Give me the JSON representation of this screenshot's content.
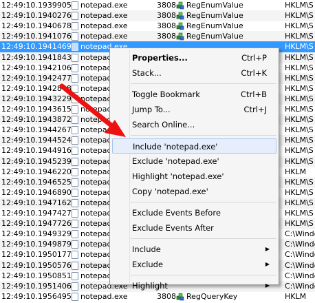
{
  "events": [
    {
      "time": "12:49:10.1939905",
      "process": "notepad.exe",
      "pid": "3808",
      "operation": "RegEnumValue",
      "path": "HKLM\\S"
    },
    {
      "time": "12:49:10.1940276",
      "process": "notepad.exe",
      "pid": "3808",
      "operation": "RegEnumValue",
      "path": "HKLM\\S"
    },
    {
      "time": "12:49:10.1940678",
      "process": "notepad.exe",
      "pid": "3808",
      "operation": "RegEnumValue",
      "path": "HKLM\\S"
    },
    {
      "time": "12:49:10.1941076",
      "process": "notepad.exe",
      "pid": "3808",
      "operation": "RegEnumValue",
      "path": "HKLM\\S"
    },
    {
      "time": "12:49:10.1941469",
      "process": "notepad.exe",
      "pid": "",
      "operation": "",
      "path": "HKLM\\S",
      "selected": true
    },
    {
      "time": "12:49:10.1941843",
      "process": "notepad.exe",
      "pid": "",
      "operation": "",
      "path": "HKLM\\S"
    },
    {
      "time": "12:49:10.1942106",
      "process": "notepad.exe",
      "pid": "",
      "operation": "",
      "path": "HKLM\\S"
    },
    {
      "time": "12:49:10.1942477",
      "process": "notepad.exe",
      "pid": "",
      "operation": "",
      "path": "HKLM\\S"
    },
    {
      "time": "12:49:10.1942848",
      "process": "notepad.exe",
      "pid": "",
      "operation": "",
      "path": "HKLM\\S"
    },
    {
      "time": "12:49:10.1943229",
      "process": "notepad.exe",
      "pid": "",
      "operation": "",
      "path": "HKLM\\S"
    },
    {
      "time": "12:49:10.1943615",
      "process": "notepad.exe",
      "pid": "",
      "operation": "",
      "path": "HKLM\\S"
    },
    {
      "time": "12:49:10.1943872",
      "process": "notepad.exe",
      "pid": "",
      "operation": "",
      "path": "HKLM\\S"
    },
    {
      "time": "12:49:10.1944267",
      "process": "notepad.exe",
      "pid": "",
      "operation": "",
      "path": "HKLM\\S"
    },
    {
      "time": "12:49:10.1944524",
      "process": "notepad.exe",
      "pid": "",
      "operation": "",
      "path": "HKLM\\S"
    },
    {
      "time": "12:49:10.1944916",
      "process": "notepad.exe",
      "pid": "",
      "operation": "",
      "path": "HKLM\\S"
    },
    {
      "time": "12:49:10.1945239",
      "process": "notepad.exe",
      "pid": "",
      "operation": "",
      "path": "HKLM\\S"
    },
    {
      "time": "12:49:10.1946220",
      "process": "notepad.exe",
      "pid": "",
      "operation": "",
      "path": "HKLM"
    },
    {
      "time": "12:49:10.1946525",
      "process": "notepad.exe",
      "pid": "",
      "operation": "",
      "path": "HKLM\\S"
    },
    {
      "time": "12:49:10.1946890",
      "process": "notepad.exe",
      "pid": "",
      "operation": "",
      "path": "HKLM\\S"
    },
    {
      "time": "12:49:10.1947162",
      "process": "notepad.exe",
      "pid": "",
      "operation": "",
      "path": "HKLM\\S"
    },
    {
      "time": "12:49:10.1947427",
      "process": "notepad.exe",
      "pid": "",
      "operation": "",
      "path": "HKLM\\S"
    },
    {
      "time": "12:49:10.1947726",
      "process": "notepad.exe",
      "pid": "",
      "operation": "",
      "path": "HKLM\\S"
    },
    {
      "time": "12:49:10.1949329",
      "process": "notepad.exe",
      "pid": "",
      "operation": "",
      "path": "C:\\Windo"
    },
    {
      "time": "12:49:10.1949879",
      "process": "notepad.exe",
      "pid": "",
      "operation": "",
      "path": "C:\\Windo"
    },
    {
      "time": "12:49:10.1950177",
      "process": "notepad.exe",
      "pid": "",
      "operation": "",
      "path": "C:\\Windo"
    },
    {
      "time": "12:49:10.1950576",
      "process": "notepad.exe",
      "pid": "",
      "operation": "",
      "path": "C:\\Windo"
    },
    {
      "time": "12:49:10.1950851",
      "process": "notepad.exe",
      "pid": "",
      "operation": "",
      "path": "C:\\Windo"
    },
    {
      "time": "12:49:10.1951406",
      "process": "notepad.exe",
      "pid": "",
      "operation": "",
      "path": "C:\\Windo"
    },
    {
      "time": "12:49:10.1956495",
      "process": "notepad.exe",
      "pid": "3808",
      "operation": "RegQueryKey",
      "path": "HKLM"
    }
  ],
  "context_menu": {
    "items": [
      {
        "label": "Properties...",
        "shortcut": "Ctrl+P",
        "bold": true
      },
      {
        "label": "Stack...",
        "shortcut": "Ctrl+K"
      },
      {
        "separator": true
      },
      {
        "label": "Toggle Bookmark",
        "shortcut": "Ctrl+B"
      },
      {
        "label": "Jump To...",
        "shortcut": "Ctrl+J"
      },
      {
        "label": "Search Online...",
        "shortcut": ""
      },
      {
        "separator": true
      },
      {
        "label": "Include 'notepad.exe'",
        "shortcut": "",
        "highlighted": true
      },
      {
        "label": "Exclude 'notepad.exe'",
        "shortcut": ""
      },
      {
        "label": "Highlight 'notepad.exe'",
        "shortcut": ""
      },
      {
        "label": "Copy 'notepad.exe'",
        "shortcut": ""
      },
      {
        "separator": true
      },
      {
        "label": "Exclude Events Before",
        "shortcut": ""
      },
      {
        "label": "Exclude Events After",
        "shortcut": ""
      },
      {
        "separator": true
      },
      {
        "label": "Include",
        "shortcut": "",
        "submenu": true
      },
      {
        "label": "Exclude",
        "shortcut": "",
        "submenu": true
      },
      {
        "separator": true
      },
      {
        "label": "Highlight",
        "shortcut": "",
        "submenu": true
      }
    ]
  },
  "icons": {
    "process_icon": "notepad-document-icon",
    "operation_icon": "registry-cubes-icon",
    "submenu_arrow": "▶"
  },
  "colors": {
    "selection": "#3399ff",
    "highlight_item": "#e6eefb",
    "annotation_arrow": "#ee1111"
  }
}
